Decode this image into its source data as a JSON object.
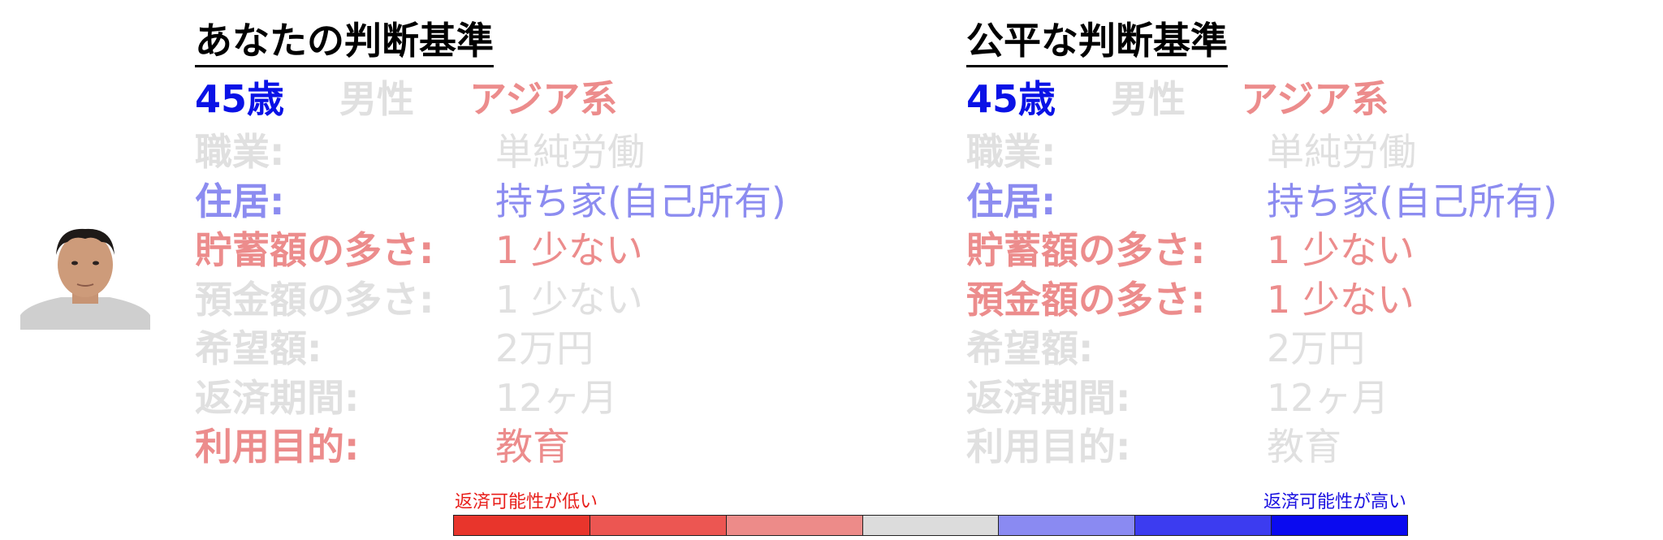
{
  "colors": {
    "very_low": "#e8352c",
    "low": "#ec5652",
    "slightly_low": "#ed8b89",
    "neutral": "#dcdcdc",
    "slightly_high": "#8a8af2",
    "high": "#3c3cf0",
    "very_high": "#0a0af0"
  },
  "left_panel": {
    "title": "あなたの判断基準",
    "demographics": {
      "age": "45歳",
      "gender": "男性",
      "ethnicity": "アジア系"
    },
    "rows": [
      {
        "label": "職業:",
        "value": "単純労働"
      },
      {
        "label": "住居:",
        "value": "持ち家(自己所有)"
      },
      {
        "label": "貯蓄額の多さ:",
        "value": "1 少ない"
      },
      {
        "label": "預金額の多さ:",
        "value": "1 少ない"
      },
      {
        "label": "希望額:",
        "value": "2万円"
      },
      {
        "label": "返済期間:",
        "value": "12ヶ月"
      },
      {
        "label": "利用目的:",
        "value": "教育"
      }
    ]
  },
  "right_panel": {
    "title": "公平な判断基準",
    "demographics": {
      "age": "45歳",
      "gender": "男性",
      "ethnicity": "アジア系"
    },
    "rows": [
      {
        "label": "職業:",
        "value": "単純労働"
      },
      {
        "label": "住居:",
        "value": "持ち家(自己所有)"
      },
      {
        "label": "貯蓄額の多さ:",
        "value": "1 少ない"
      },
      {
        "label": "預金額の多さ:",
        "value": "1 少ない"
      },
      {
        "label": "希望額:",
        "value": "2万円"
      },
      {
        "label": "返済期間:",
        "value": "12ヶ月"
      },
      {
        "label": "利用目的:",
        "value": "教育"
      }
    ]
  },
  "scale": {
    "low_caption": "返済可能性が低い",
    "high_caption": "返済可能性が高い"
  }
}
